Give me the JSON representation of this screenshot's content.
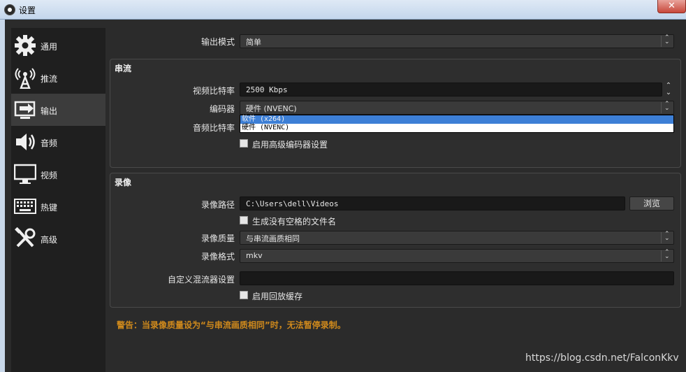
{
  "window": {
    "title": "设置",
    "close_label": "✕"
  },
  "sidebar": {
    "items": [
      {
        "label": "通用",
        "icon": "gear-icon"
      },
      {
        "label": "推流",
        "icon": "broadcast-icon"
      },
      {
        "label": "输出",
        "icon": "output-icon"
      },
      {
        "label": "音频",
        "icon": "speaker-icon"
      },
      {
        "label": "视频",
        "icon": "monitor-icon"
      },
      {
        "label": "热键",
        "icon": "keyboard-icon"
      },
      {
        "label": "高级",
        "icon": "tools-icon"
      }
    ],
    "active_index": 2
  },
  "output_mode": {
    "label": "输出模式",
    "value": "简单"
  },
  "streaming": {
    "title": "串流",
    "video_bitrate": {
      "label": "视频比特率",
      "value": "2500 Kbps"
    },
    "encoder": {
      "label": "编码器",
      "value": "硬件 (NVENC)",
      "options": [
        "软件 (x264)",
        "硬件 (NVENC)"
      ],
      "highlighted_option": "软件 (x264)"
    },
    "audio_bitrate": {
      "label": "音频比特率"
    },
    "advanced_encoder": {
      "label": "启用高级编码器设置",
      "checked": false
    }
  },
  "recording": {
    "title": "录像",
    "path": {
      "label": "录像路径",
      "value": "C:\\Users\\dell\\Videos",
      "browse_label": "浏览"
    },
    "no_space_filename": {
      "label": "生成没有空格的文件名",
      "checked": false
    },
    "quality": {
      "label": "录像质量",
      "value": "与串流画质相同"
    },
    "format": {
      "label": "录像格式",
      "value": "mkv"
    },
    "muxer_settings": {
      "label": "自定义混流器设置",
      "value": ""
    },
    "replay_buffer": {
      "label": "启用回放缓存",
      "checked": false
    }
  },
  "warning": "警告：当录像质量设为“与串流画质相同”时，无法暂停录制。",
  "watermark": "https://blog.csdn.net/FalconKkv",
  "colors": {
    "accent": "#3d7fd6",
    "warning": "#d08a1c",
    "background": "#2b2b2b"
  }
}
